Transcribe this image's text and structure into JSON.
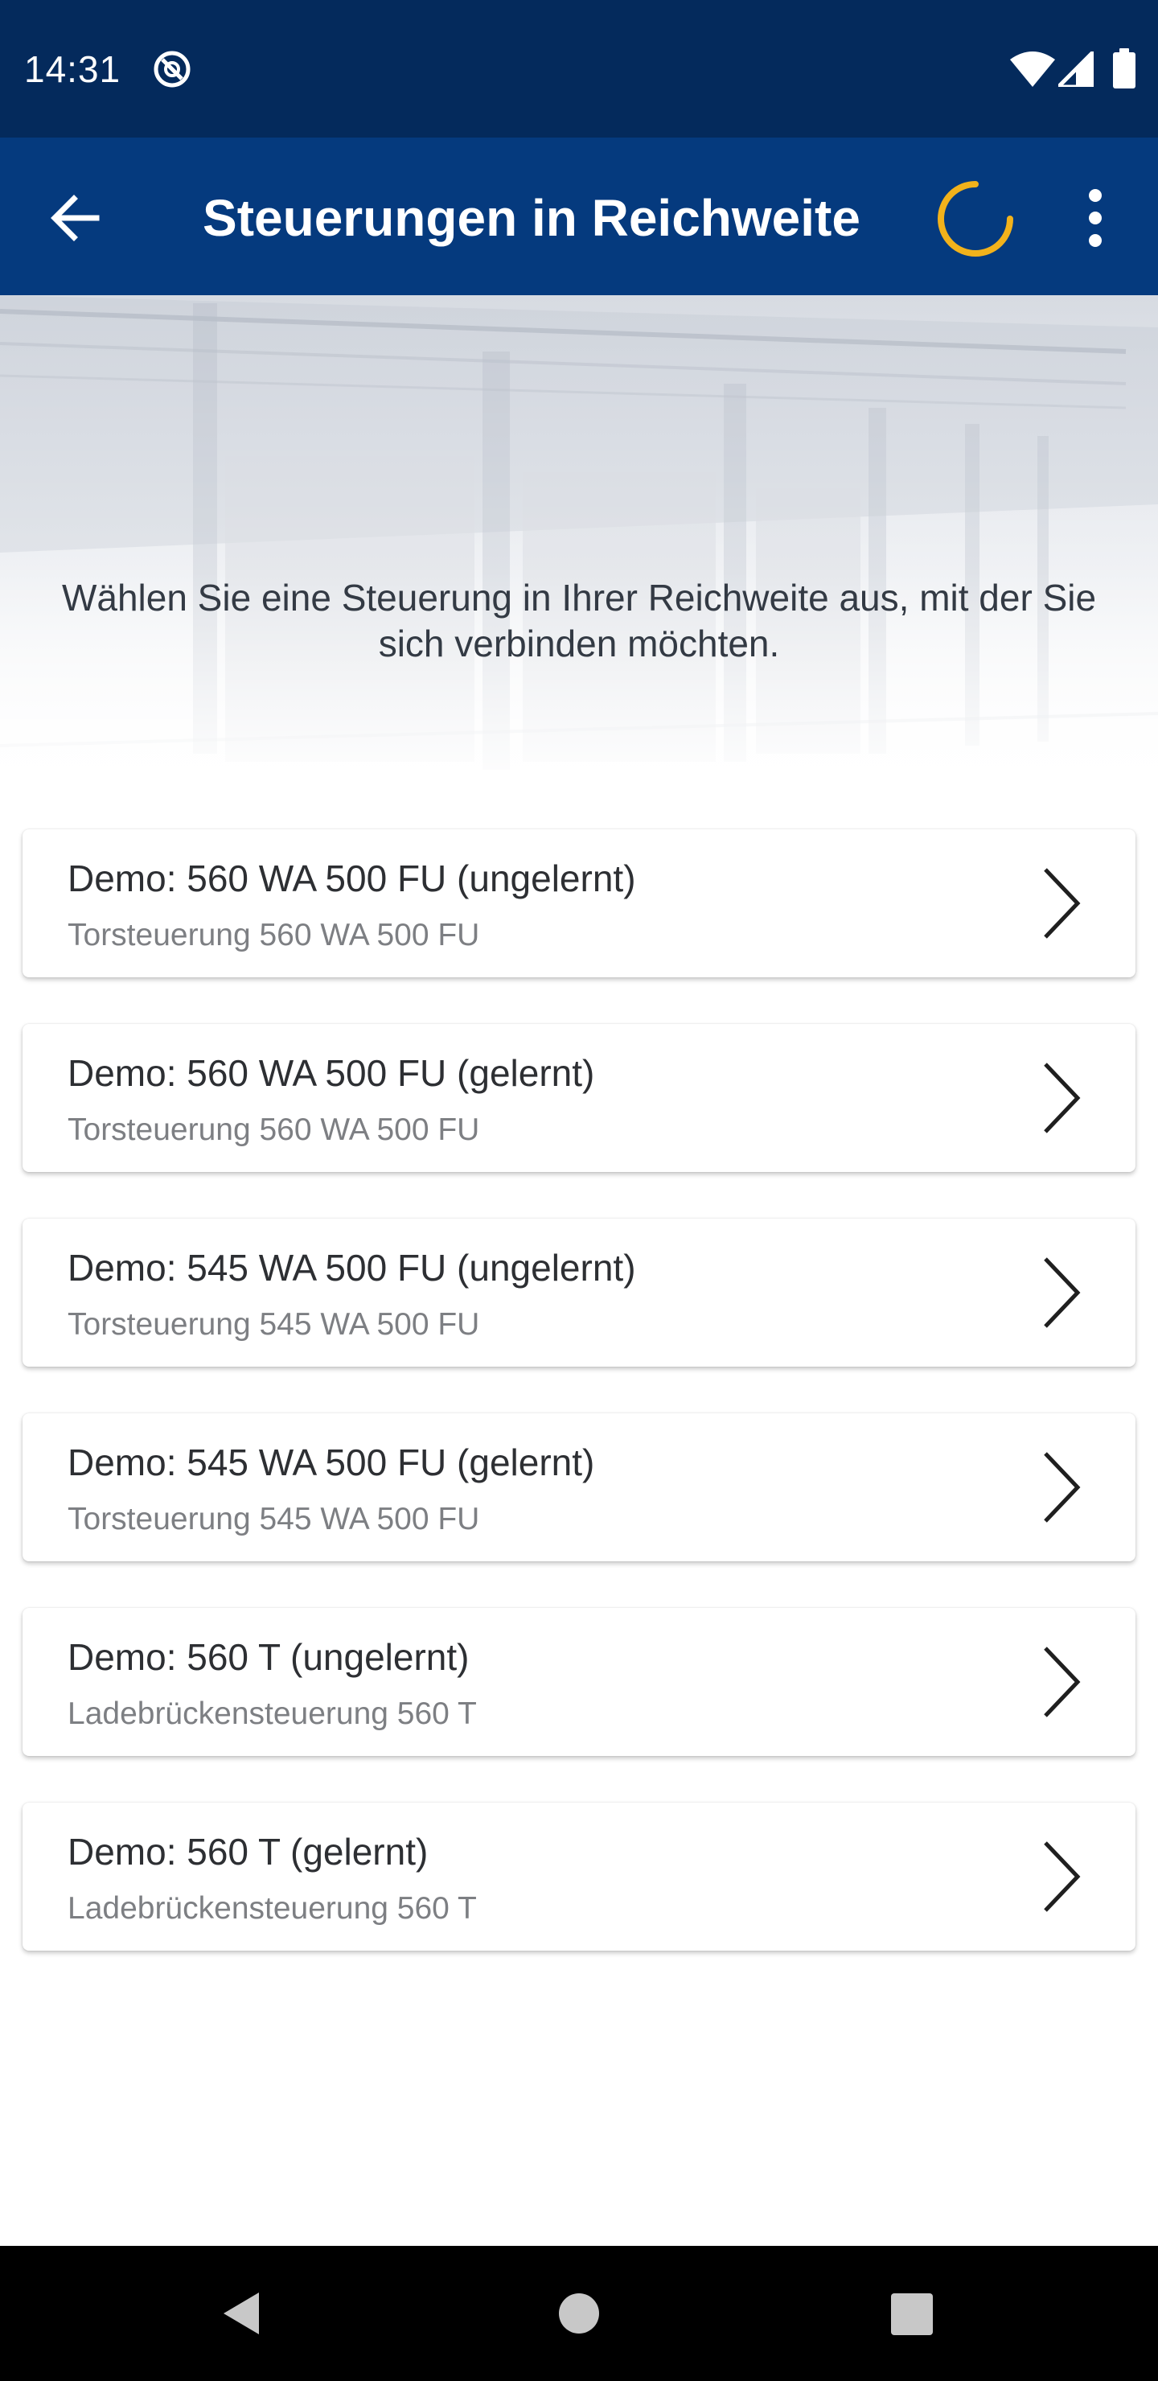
{
  "status_bar": {
    "time": "14:31",
    "icons": [
      "sync-icon",
      "wifi-icon",
      "signal-icon",
      "battery-icon"
    ]
  },
  "app_bar": {
    "title": "Steuerungen in Reichweite",
    "back_icon": "arrow-left-icon",
    "loading_indicator": "spinner-icon",
    "overflow_icon": "more-vert-icon"
  },
  "header": {
    "instruction": "Wählen Sie eine Steuerung in Ihrer Reichweite aus, mit der Sie sich verbinden möchten."
  },
  "devices": [
    {
      "name": "Demo: 560 WA 500 FU (ungelernt)",
      "type": "Torsteuerung 560 WA 500 FU"
    },
    {
      "name": "Demo: 560 WA 500 FU (gelernt)",
      "type": "Torsteuerung 560 WA 500 FU"
    },
    {
      "name": "Demo: 545 WA 500 FU (ungelernt)",
      "type": "Torsteuerung 545 WA 500 FU"
    },
    {
      "name": "Demo: 545 WA 500 FU (gelernt)",
      "type": "Torsteuerung 545 WA 500 FU"
    },
    {
      "name": "Demo: 560 T (ungelernt)",
      "type": "Ladebrückensteuerung 560 T"
    },
    {
      "name": "Demo: 560 T (gelernt)",
      "type": "Ladebrückensteuerung 560 T"
    }
  ],
  "nav_bar": {
    "icons": [
      "nav-back-icon",
      "nav-home-icon",
      "nav-recents-icon"
    ]
  },
  "colors": {
    "status_bar": "#042a5c",
    "app_bar": "#053a7e",
    "spinner_accent": "#f2b21b",
    "primary_text": "#2d2f33",
    "secondary_text": "#7d7f83"
  }
}
